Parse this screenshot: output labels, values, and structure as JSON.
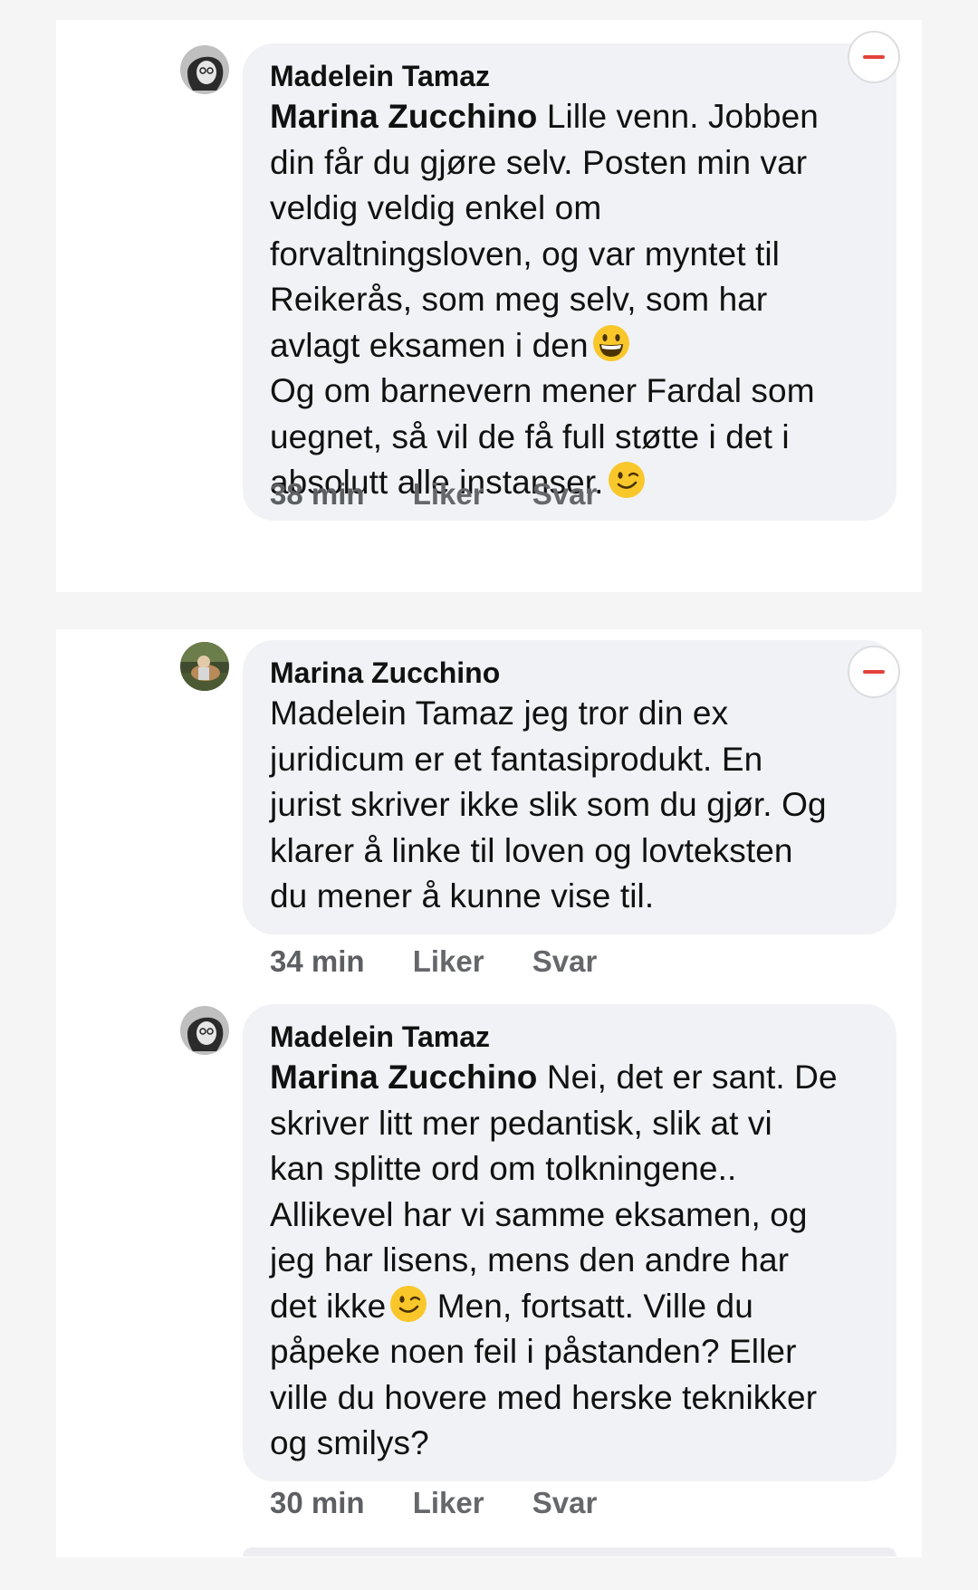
{
  "comments": [
    {
      "author": "Madelein Tamaz",
      "mention": "Marina Zucchino",
      "lines": [
        " Lille venn. Jobben",
        "din får du gjøre selv. Posten min var",
        "veldig veldig enkel om",
        "forvaltningsloven, og var myntet til",
        "Reikerås, som meg selv, som har",
        "avlagt eksamen i den",
        "Og om barnevern mener Fardal som",
        "uegnet, så vil de få full støtte i det i",
        "absolutt alle instanser."
      ],
      "time": "38 min",
      "like": "Liker",
      "reply": "Svar"
    },
    {
      "author": "Marina Zucchino",
      "lines": [
        "Madelein Tamaz jeg tror din ex",
        "juridicum er et fantasiprodukt. En",
        "jurist skriver ikke slik som du gjør. Og",
        "klarer å linke til loven og lovteksten",
        "du mener å kunne vise til."
      ],
      "time": "34 min",
      "like": "Liker",
      "reply": "Svar"
    },
    {
      "author": "Madelein Tamaz",
      "mention": "Marina Zucchino",
      "lines": [
        " Nei, det er sant. De",
        "skriver litt mer pedantisk, slik at vi",
        "kan splitte ord om tolkningene..",
        "Allikevel har vi samme eksamen, og",
        "jeg har lisens, mens den andre har",
        "det ikke",
        " Men, fortsatt. Ville du",
        "påpeke noen feil i påstanden? Eller",
        "ville du hovere med herske teknikker",
        "og smilys?"
      ],
      "time": "30 min",
      "like": "Liker",
      "reply": "Svar"
    }
  ],
  "icons": {
    "collapse": "minus-circle-icon",
    "emoji_grin": "grinning-face-icon",
    "emoji_wink": "winking-face-icon"
  },
  "colors": {
    "bubble": "#f0f2f5",
    "meta_text": "#65676b",
    "collapse_minus": "#e4423c",
    "emoji_yellow": "#f9c72a"
  }
}
